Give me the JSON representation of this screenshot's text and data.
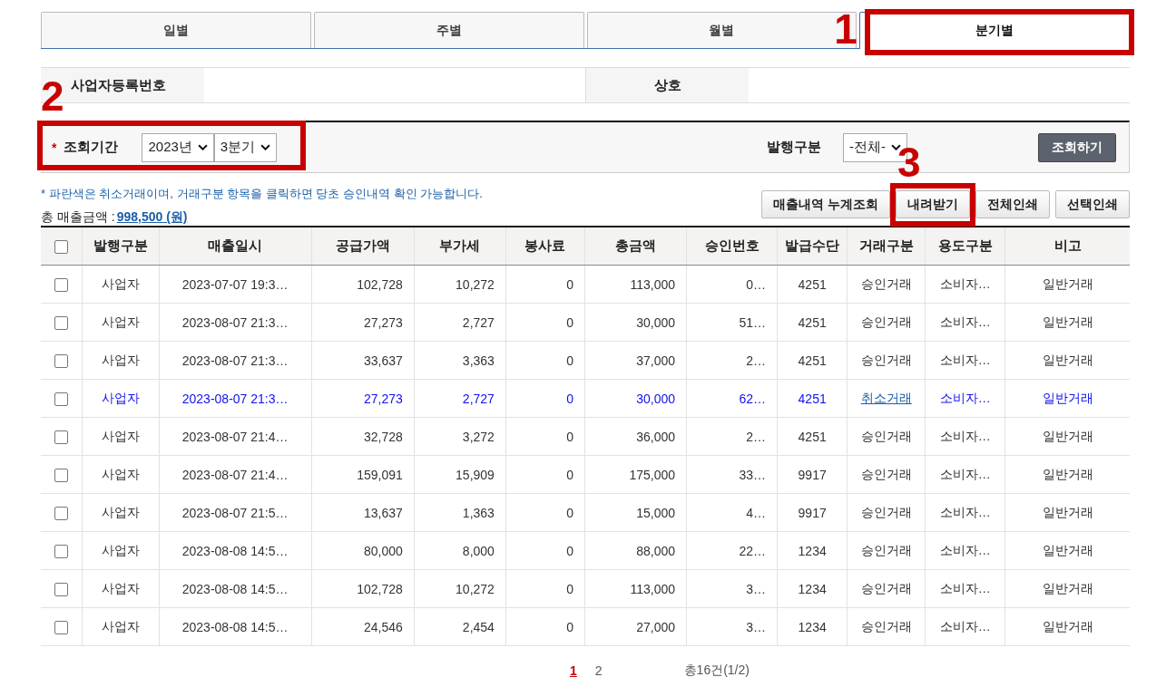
{
  "tabs": [
    {
      "label": "일별",
      "selected": false
    },
    {
      "label": "주별",
      "selected": false
    },
    {
      "label": "월별",
      "selected": false
    },
    {
      "label": "분기별",
      "selected": true,
      "annotation": "1"
    }
  ],
  "info": {
    "business_number_label": "사업자등록번호",
    "company_label": "상호"
  },
  "search": {
    "required_mark": "*",
    "period_label": "조회기간",
    "year": "2023년",
    "quarter": "3분기",
    "annotation": "2",
    "issue_type_label": "발행구분",
    "issue_type": "-전체-",
    "search_button": "조회하기"
  },
  "note": "* 파란색은 취소거래이며, 거래구분 항목을 클릭하면 당초 승인내역 확인 가능합니다.",
  "total": {
    "label": "총 매출금액 :",
    "amount": "998,500 (원)"
  },
  "actions": [
    {
      "label": "매출내역 누계조회"
    },
    {
      "label": "내려받기",
      "annotation": "3"
    },
    {
      "label": "전체인쇄"
    },
    {
      "label": "선택인쇄"
    }
  ],
  "table": {
    "select_all_checked": false,
    "columns": [
      "발행구분",
      "매출일시",
      "공급가액",
      "부가세",
      "봉사료",
      "총금액",
      "승인번호",
      "발급수단",
      "거래구분",
      "용도구분",
      "비고"
    ],
    "rows": [
      {
        "checked": false,
        "cancelled": false,
        "cells": [
          "사업자",
          "2023-07-07 19:3…",
          "102,728",
          "10,272",
          "0",
          "113,000",
          "0…",
          "4251",
          "승인거래",
          "소비자…",
          "일반거래"
        ]
      },
      {
        "checked": false,
        "cancelled": false,
        "cells": [
          "사업자",
          "2023-08-07 21:3…",
          "27,273",
          "2,727",
          "0",
          "30,000",
          "51…",
          "4251",
          "승인거래",
          "소비자…",
          "일반거래"
        ]
      },
      {
        "checked": false,
        "cancelled": false,
        "cells": [
          "사업자",
          "2023-08-07 21:3…",
          "33,637",
          "3,363",
          "0",
          "37,000",
          "2…",
          "4251",
          "승인거래",
          "소비자…",
          "일반거래"
        ]
      },
      {
        "checked": false,
        "cancelled": true,
        "cells": [
          "사업자",
          "2023-08-07 21:3…",
          "27,273",
          "2,727",
          "0",
          "30,000",
          "62…",
          "4251",
          "취소거래",
          "소비자…",
          "일반거래"
        ]
      },
      {
        "checked": false,
        "cancelled": false,
        "cells": [
          "사업자",
          "2023-08-07 21:4…",
          "32,728",
          "3,272",
          "0",
          "36,000",
          "2…",
          "4251",
          "승인거래",
          "소비자…",
          "일반거래"
        ]
      },
      {
        "checked": false,
        "cancelled": false,
        "cells": [
          "사업자",
          "2023-08-07 21:4…",
          "159,091",
          "15,909",
          "0",
          "175,000",
          "33…",
          "9917",
          "승인거래",
          "소비자…",
          "일반거래"
        ]
      },
      {
        "checked": false,
        "cancelled": false,
        "cells": [
          "사업자",
          "2023-08-07 21:5…",
          "13,637",
          "1,363",
          "0",
          "15,000",
          "4…",
          "9917",
          "승인거래",
          "소비자…",
          "일반거래"
        ]
      },
      {
        "checked": false,
        "cancelled": false,
        "cells": [
          "사업자",
          "2023-08-08 14:5…",
          "80,000",
          "8,000",
          "0",
          "88,000",
          "22…",
          "1234",
          "승인거래",
          "소비자…",
          "일반거래"
        ]
      },
      {
        "checked": false,
        "cancelled": false,
        "cells": [
          "사업자",
          "2023-08-08 14:5…",
          "102,728",
          "10,272",
          "0",
          "113,000",
          "3…",
          "1234",
          "승인거래",
          "소비자…",
          "일반거래"
        ]
      },
      {
        "checked": false,
        "cancelled": false,
        "cells": [
          "사업자",
          "2023-08-08 14:5…",
          "24,546",
          "2,454",
          "0",
          "27,000",
          "3…",
          "1234",
          "승인거래",
          "소비자…",
          "일반거래"
        ]
      }
    ]
  },
  "pagination": {
    "pages": [
      {
        "label": "1",
        "selected": true
      },
      {
        "label": "2",
        "selected": false
      }
    ],
    "summary": "총16건(1/2)"
  }
}
